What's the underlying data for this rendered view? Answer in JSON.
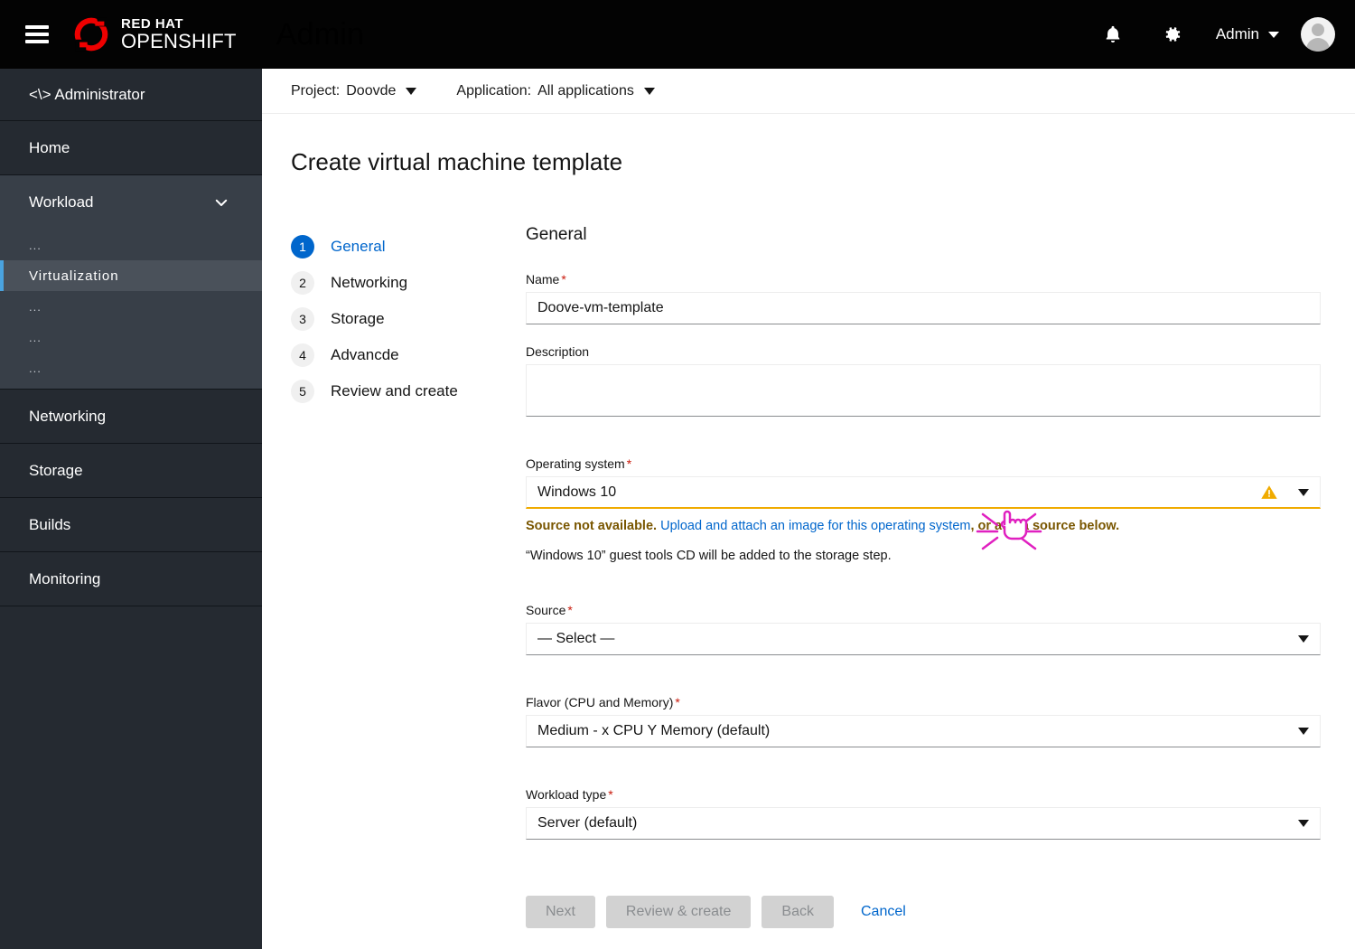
{
  "masthead": {
    "menu_icon": "hamburger-icon",
    "brand_line1": "RED HAT",
    "brand_line2": "OPENSHIFT",
    "app_title": "Admin",
    "bell_icon": "bell-icon",
    "gear_icon": "gear-icon",
    "user_label": "Admin",
    "avatar_icon": "user-avatar-icon"
  },
  "sidebar": {
    "perspective": "<\\> Administrator",
    "items": [
      {
        "label": "Home",
        "type": "item"
      },
      {
        "label": "Workload",
        "type": "group",
        "expanded": true,
        "children": [
          {
            "label": "...",
            "active": false
          },
          {
            "label": "Virtualization",
            "active": true
          },
          {
            "label": "...",
            "active": false
          },
          {
            "label": "...",
            "active": false
          },
          {
            "label": "...",
            "active": false
          }
        ]
      },
      {
        "label": "Networking",
        "type": "item"
      },
      {
        "label": "Storage",
        "type": "item"
      },
      {
        "label": "Builds",
        "type": "item"
      },
      {
        "label": "Monitoring",
        "type": "item"
      }
    ],
    "active_color": "#4aa3df"
  },
  "context_bar": {
    "project_label": "Project:",
    "project_value": "Doovde",
    "application_label": "Application:",
    "application_value": "All applications"
  },
  "page": {
    "title": "Create virtual machine template"
  },
  "wizard": {
    "steps": [
      {
        "num": "1",
        "label": "General",
        "active": true
      },
      {
        "num": "2",
        "label": "Networking",
        "active": false
      },
      {
        "num": "3",
        "label": "Storage",
        "active": false
      },
      {
        "num": "4",
        "label": "Advancde",
        "active": false
      },
      {
        "num": "5",
        "label": "Review and create",
        "active": false
      }
    ]
  },
  "form": {
    "section_title": "General",
    "name_label": "Name",
    "name_value": "Doove-vm-template",
    "description_label": "Description",
    "description_value": "",
    "os_label": "Operating system",
    "os_value": "Windows 10",
    "os_warning_icon": "warning-triangle-icon",
    "warn_prefix": "Source not available.",
    "warn_link": "Upload and attach an image for this operating system",
    "warn_suffix": ", or add a source below.",
    "guest_tools_note": "“Windows 10” guest tools CD will be added to the storage step.",
    "source_label": "Source",
    "source_value": "— Select —",
    "flavor_label": "Flavor (CPU and Memory)",
    "flavor_value": "Medium - x CPU Y Memory (default)",
    "workload_label": "Workload type",
    "workload_value": "Server (default)",
    "required_mark": "*"
  },
  "actions": {
    "next": "Next",
    "review_create": "Review & create",
    "back": "Back",
    "cancel": "Cancel"
  },
  "cursor": {
    "icon": "pointing-hand-click-cursor",
    "color": "#e020c0"
  },
  "colors": {
    "masthead_bg": "#030303",
    "sidebar_bg": "#252a31",
    "sidebar_group_bg": "#383f48",
    "brand_accent": "#c9190b",
    "app_title": "#c919c",
    "link": "#06c",
    "warning": "#f0ab00",
    "warning_text": "#795600",
    "required": "#c9190b"
  }
}
